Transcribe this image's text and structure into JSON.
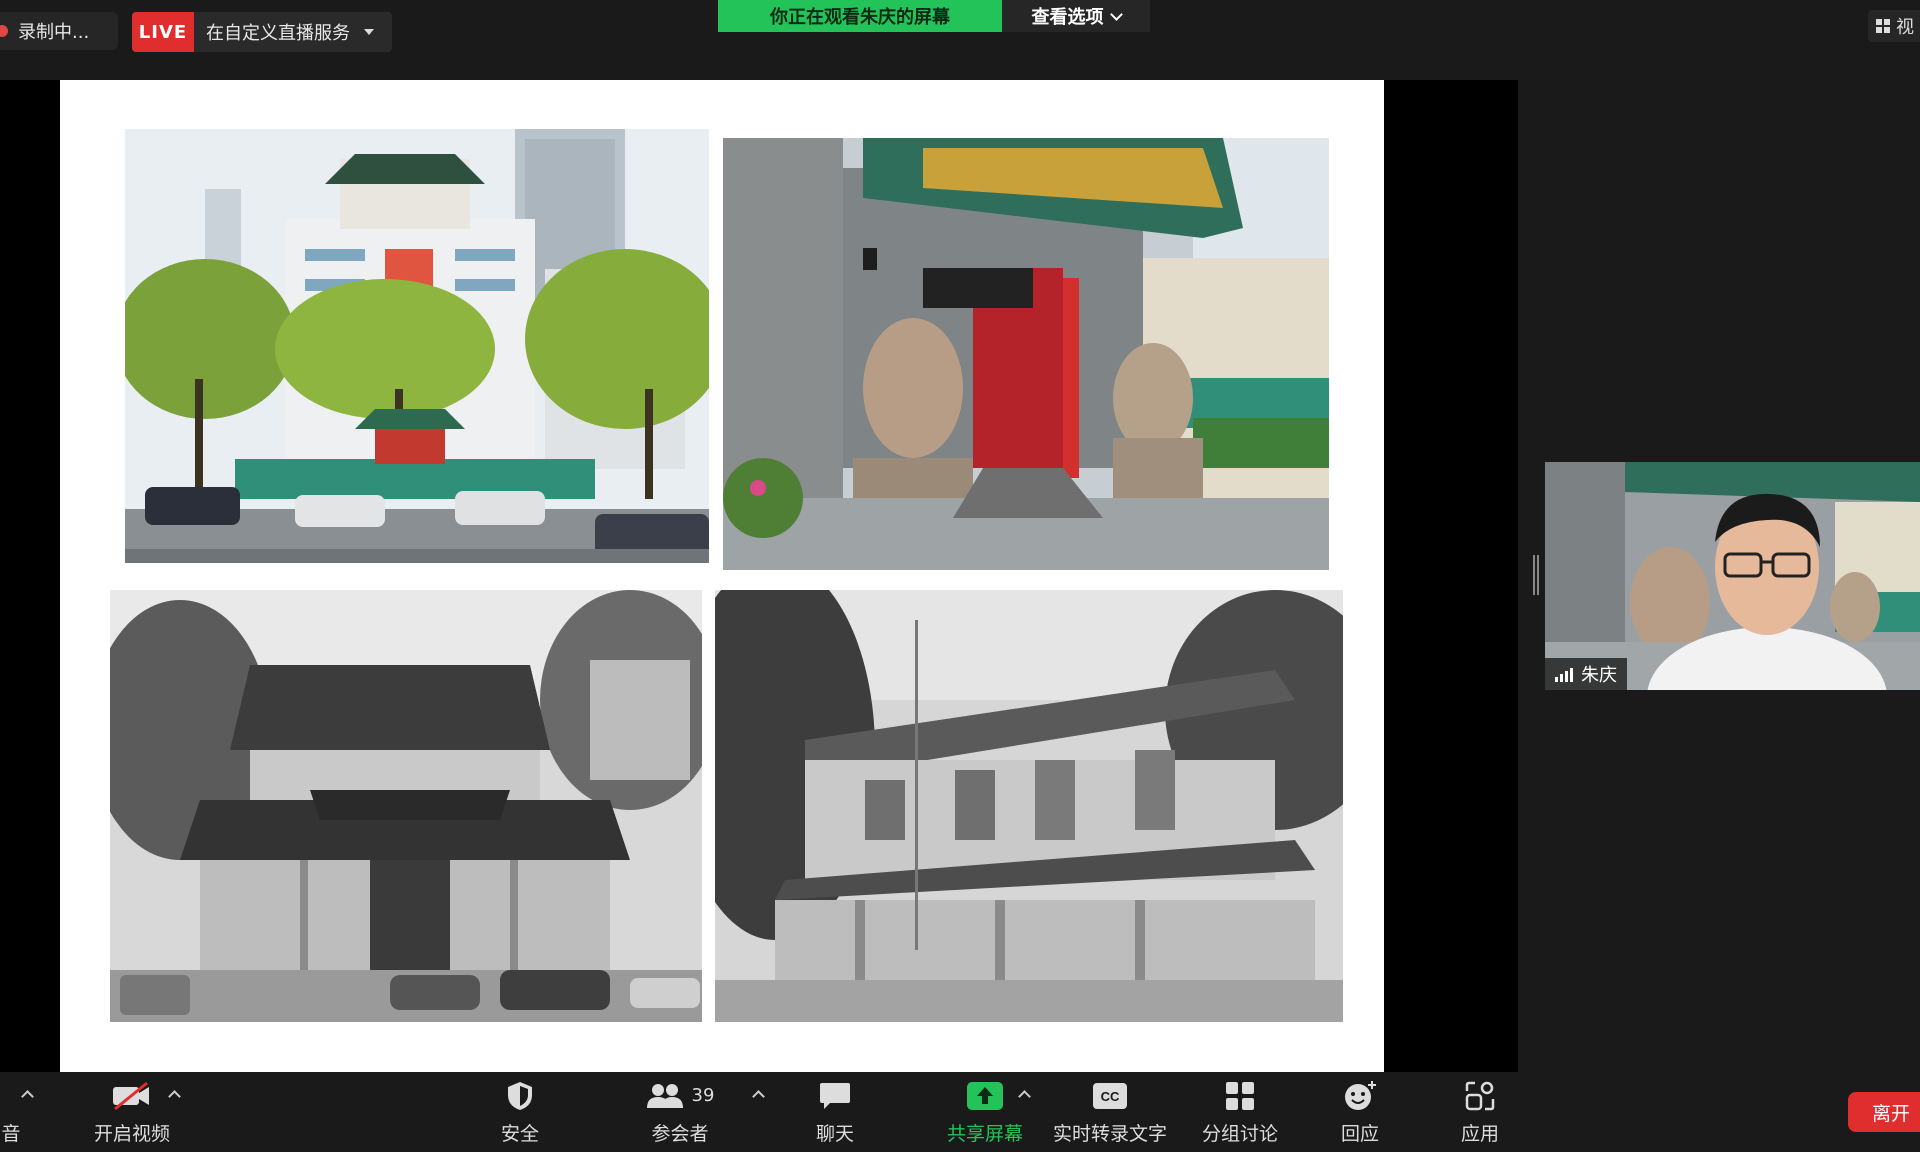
{
  "top_bar": {
    "recording_label": "录制中...",
    "live_badge": "LIVE",
    "live_service": "在自定义直播服务",
    "viewing_banner": "你正在观看朱庆的屏幕",
    "view_options": "查看选项",
    "view_button": "视"
  },
  "participant": {
    "name": "朱庆"
  },
  "toolbar": {
    "audio_label": "音",
    "video_label": "开启视频",
    "security_label": "安全",
    "participants_label": "参会者",
    "participants_count": "39",
    "chat_label": "聊天",
    "share_label": "共享屏幕",
    "captions_label": "实时转录文字",
    "breakout_label": "分组讨论",
    "reactions_label": "回应",
    "apps_label": "应用",
    "leave_label": "离开"
  },
  "colors": {
    "background": "#1a1a1a",
    "accent_green": "#24c35a",
    "live_red": "#e02d2d"
  }
}
